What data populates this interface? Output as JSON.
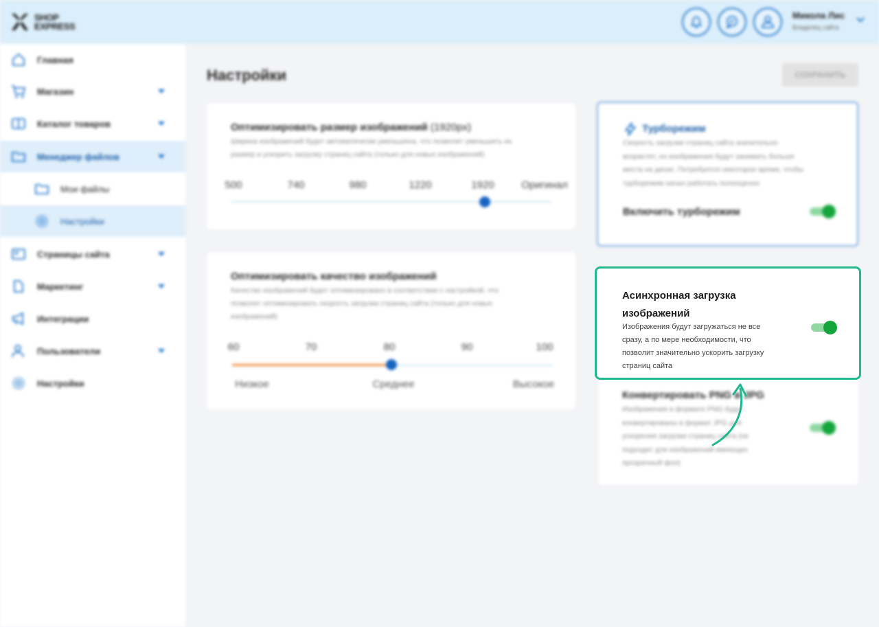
{
  "header": {
    "logo_line1": "SHOP",
    "logo_line2": "EXPRESS",
    "user_name": "Микола Лис",
    "user_role": "Владелец сайта",
    "icons": [
      "bell-icon",
      "chat-icon",
      "user-icon",
      "chevron-down-icon"
    ]
  },
  "sidebar": {
    "items": [
      {
        "label": "Главная",
        "icon": "home-icon"
      },
      {
        "label": "Магазин",
        "icon": "cart-icon",
        "expandable": true
      },
      {
        "label": "Каталог товаров",
        "icon": "book-icon",
        "expandable": true
      },
      {
        "label": "Менеджер файлов",
        "icon": "folder-icon",
        "expandable": true,
        "active": true
      },
      {
        "label": "Мои файлы",
        "icon": "folder-icon",
        "sub": true
      },
      {
        "label": "Настройки",
        "icon": "gear-icon",
        "sub": true,
        "active": true
      },
      {
        "label": "Страницы сайта",
        "icon": "page-icon",
        "expandable": true
      },
      {
        "label": "Маркетинг",
        "icon": "tag-icon",
        "expandable": true
      },
      {
        "label": "Интеграции",
        "icon": "megaphone-icon"
      },
      {
        "label": "Пользователи",
        "icon": "users-icon",
        "expandable": true
      },
      {
        "label": "Настройки",
        "icon": "gear-icon"
      }
    ]
  },
  "main": {
    "title": "Настройки",
    "save_label": "СОХРАНИТЬ",
    "size_card": {
      "title": "Оптимизировать размер изображений",
      "title_suffix": "(1920px)",
      "desc_line1": "Ширина изображений будет автоматически уменьшена, что позволит уменьшить их",
      "desc_line2": "размер и ускорить загрузку страниц сайта (только для новых изображений)",
      "ticks": [
        "500",
        "740",
        "980",
        "1220",
        "1920",
        "Оригинал"
      ],
      "selected": "1920"
    },
    "quality_card": {
      "title": "Оптимизировать качество изображений",
      "desc_line1": "Качество изображений будет оптимизировано в соответствии с настройкой, что",
      "desc_line2": "позволит оптимизировать скорость загрузки страниц сайта (только для новых",
      "desc_line3": "изображений)",
      "ticks": [
        "60",
        "70",
        "80",
        "90",
        "100"
      ],
      "value": 80,
      "low": "Низкое",
      "mid": "Среднее",
      "high": "Высокое"
    },
    "turbo_card": {
      "title": "Турборежим",
      "desc_line1": "Скорость загрузки страниц сайта значительно",
      "desc_line2": "возрастет, но изображения будут занимать больше",
      "desc_line3": "места на диске. Потребуется некоторое время, чтобы",
      "desc_line4": "турборежим начал работать полноценно",
      "toggle_label": "Включить турборежим",
      "enabled": true
    },
    "async_card": {
      "title_line1": "Асинхронная загрузка",
      "title_line2": "изображений",
      "desc_line1": "Изображения будут загружаться не все",
      "desc_line2": "сразу, а по мере необходимости, что",
      "desc_line3": "позволит значительно ускорить загрузку",
      "desc_line4": "страниц сайта",
      "enabled": true
    },
    "png_card": {
      "title": "Конвертировать PNG в JPG",
      "desc_line1": "Изображения в формате PNG будут",
      "desc_line2": "конвертированы в формат JPG для",
      "desc_line3": "ускорения загрузки страниц сайта (не",
      "desc_line4": "подходит для изображений имеющих",
      "desc_line5": "прозрачный фон)",
      "enabled": true
    }
  },
  "colors": {
    "accent": "#1d73c7",
    "highlight": "#1fb88f",
    "toggle_on": "#14a53c",
    "slider_fill": "#f58c3d"
  }
}
